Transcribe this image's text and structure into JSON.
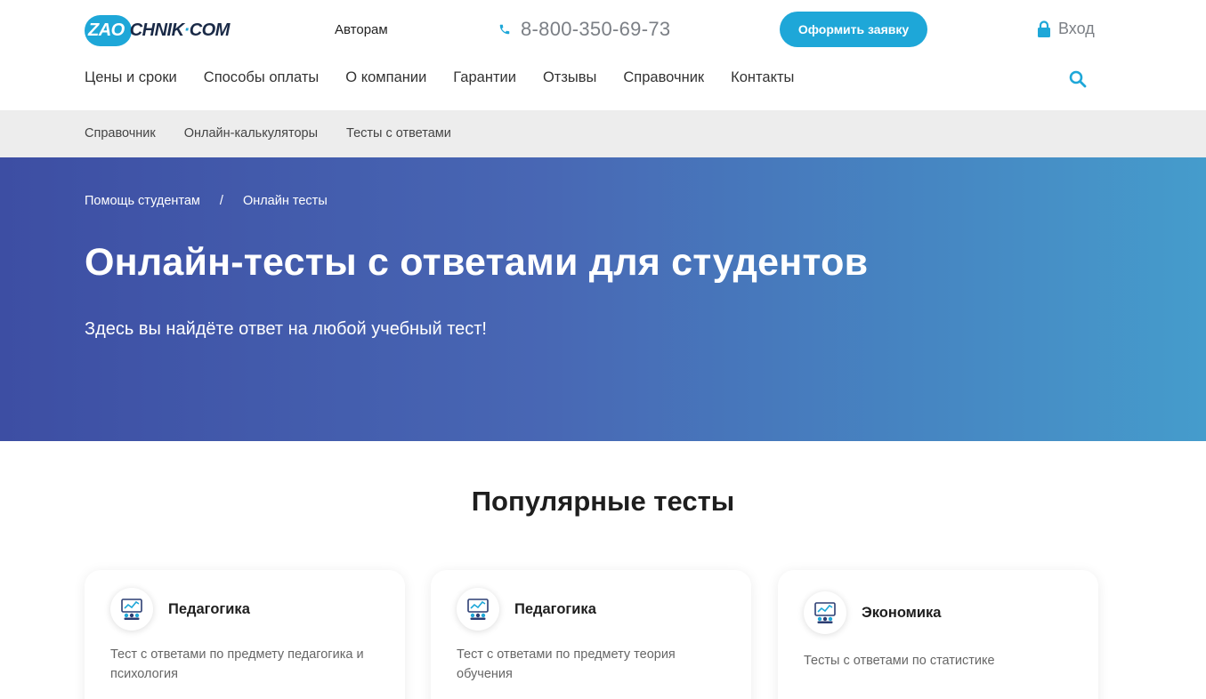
{
  "header": {
    "logo": {
      "badge": "ZAO",
      "rest": "CHNIK",
      "dot": "·",
      "suffix": "COM"
    },
    "authors_link": "Авторам",
    "phone": "8-800-350-69-73",
    "order_button": "Оформить заявку",
    "login": "Вход",
    "accent_color": "#1ea7d8"
  },
  "main_nav": [
    {
      "label": "Цены и сроки"
    },
    {
      "label": "Способы оплаты"
    },
    {
      "label": "О компании"
    },
    {
      "label": "Гарантии"
    },
    {
      "label": "Отзывы"
    },
    {
      "label": "Справочник"
    },
    {
      "label": "Контакты"
    }
  ],
  "sub_nav": [
    {
      "label": "Справочник"
    },
    {
      "label": "Онлайн-калькуляторы"
    },
    {
      "label": "Тесты с ответами"
    }
  ],
  "hero": {
    "breadcrumb": [
      "Помощь студентам",
      "/",
      "Онлайн тесты"
    ],
    "title": "Онлайн-тесты с ответами для студентов",
    "subtitle": "Здесь вы найдёте ответ на любой учебный тест!"
  },
  "popular": {
    "title": "Популярные тесты",
    "cards": [
      {
        "title": "Педагогика",
        "desc": "Тест с ответами по предмету педагогика и психология",
        "icon": "classroom-icon"
      },
      {
        "title": "Педагогика",
        "desc": "Тест с ответами по предмету теория обучения",
        "icon": "classroom-icon"
      },
      {
        "title": "Экономика",
        "desc": "Тесты с ответами по статистике",
        "icon": "classroom-icon"
      }
    ]
  }
}
